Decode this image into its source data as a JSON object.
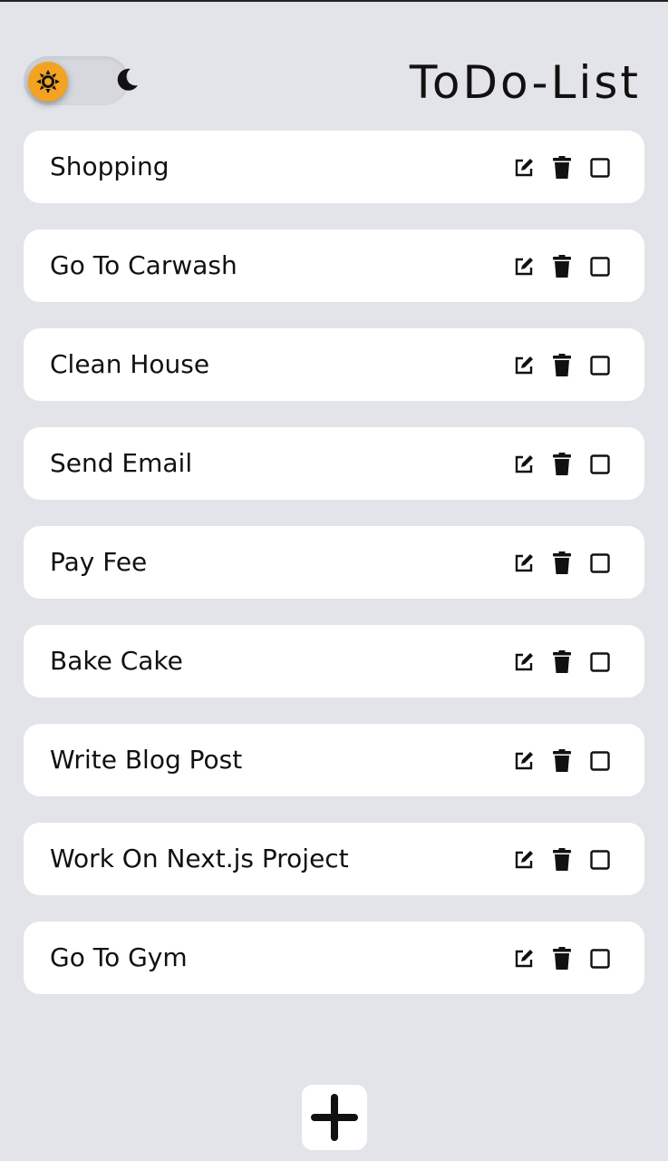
{
  "app": {
    "title": "ToDo-List"
  },
  "theme_toggle": {
    "active": "light",
    "sun_icon": "sun-icon",
    "moon_icon": "moon-icon",
    "accent": "#f2a321"
  },
  "todos": [
    {
      "label": "Shopping"
    },
    {
      "label": "Go To Carwash"
    },
    {
      "label": "Clean House"
    },
    {
      "label": "Send Email"
    },
    {
      "label": "Pay Fee"
    },
    {
      "label": "Bake Cake"
    },
    {
      "label": "Write Blog Post"
    },
    {
      "label": "Work On Next.js Project"
    },
    {
      "label": "Go To Gym"
    }
  ],
  "item_actions": [
    "edit-icon",
    "trash-icon",
    "checkbox"
  ],
  "add_button": {
    "icon": "plus-icon"
  },
  "colors": {
    "background": "#e3e4ea",
    "card": "#ffffff",
    "text": "#111111"
  }
}
